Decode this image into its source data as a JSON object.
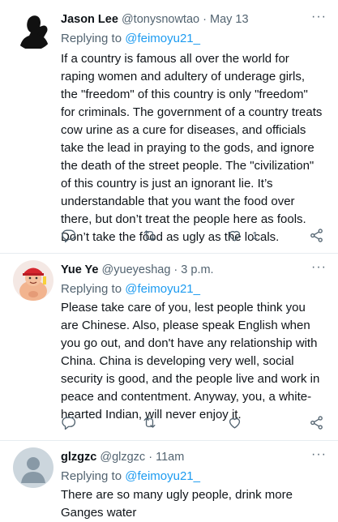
{
  "tweets": [
    {
      "name": "Jason Lee",
      "handle": "@tonysnowtao",
      "separator": "·",
      "time": "May 13",
      "replying_prefix": "Replying to ",
      "replying_to": "@feimoyu21_",
      "text": "If a country is famous all over the world for raping women and adultery of underage girls, the \"freedom\" of this country is only \"freedom\" for criminals. The government of a country treats cow urine as a cure for diseases, and officials take the lead in praying to the gods, and ignore the death of the street people. The \"civilization\" of this country is just an ignorant lie. It’s understandable that you want the food over there, but don’t treat the people here as fools. Don’t take the food as ugly as the locals.",
      "like_count": "1",
      "icons": [
        "reply-icon",
        "retweet-icon",
        "like-icon",
        "share-icon"
      ]
    },
    {
      "name": "Yue Ye",
      "handle": "@yueyeshag",
      "separator": "·",
      "time": "3 p.m.",
      "replying_prefix": "Replying to ",
      "replying_to": "@feimoyu21_",
      "text": "Please take care of you, lest people think you are Chinese. Also, please speak English when you go out, and don't have any relationship with China. China is developing very well, social security is good, and the people live and work in peace and contentment. Anyway, you, a white-hearted Indian, will never enjoy it.",
      "like_count": "",
      "icons": [
        "reply-icon",
        "retweet-icon",
        "like-icon",
        "share-icon"
      ]
    },
    {
      "name": "glzgzc",
      "handle": "@glzgzc",
      "separator": "·",
      "time": "11am",
      "replying_prefix": "Replying to ",
      "replying_to": "@feimoyu21_",
      "text": "There are so many ugly people, drink more Ganges water"
    }
  ],
  "more_label": "···",
  "colors": {
    "link": "#1d9bf0",
    "secondary": "#536471",
    "divider": "#e6ecf0"
  }
}
